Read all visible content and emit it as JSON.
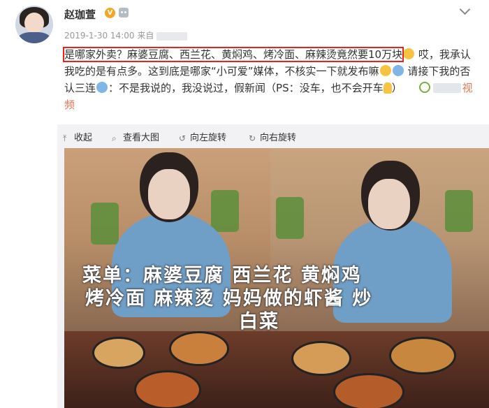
{
  "user": {
    "name": "赵珈萱",
    "badge": "V"
  },
  "post": {
    "date": "2019-1-30 14:00",
    "source_prefix": "来自",
    "highlighted_text": "是哪家外卖？麻婆豆腐、西兰花、黄焖鸡、烤冷面、麻辣烫竟然要10万块",
    "text_part1": "哎，我承认我吃的是有点多。这到底是哪家“小可爱”媒体，不核实一下就发布嘛",
    "text_part2": "请接下我的否认三连",
    "text_part3": "：不是我说的，我没说过，假新闻（PS：没车，也不会开车",
    "text_part4": "）",
    "video_link": "视频"
  },
  "toolbar": {
    "collapse": "收起",
    "view_large": "查看大图",
    "rotate_left": "向左旋转",
    "rotate_right": "向右旋转"
  },
  "image_overlay": {
    "line1": "菜单：麻婆豆腐  西兰花  黄焖鸡",
    "line2": "烤冷面  麻辣烫  妈妈做的虾酱 炒",
    "line3": "白菜"
  },
  "colors": {
    "highlight_box": "#e8231b",
    "link": "#eb7350",
    "badge": "#f5a623"
  }
}
